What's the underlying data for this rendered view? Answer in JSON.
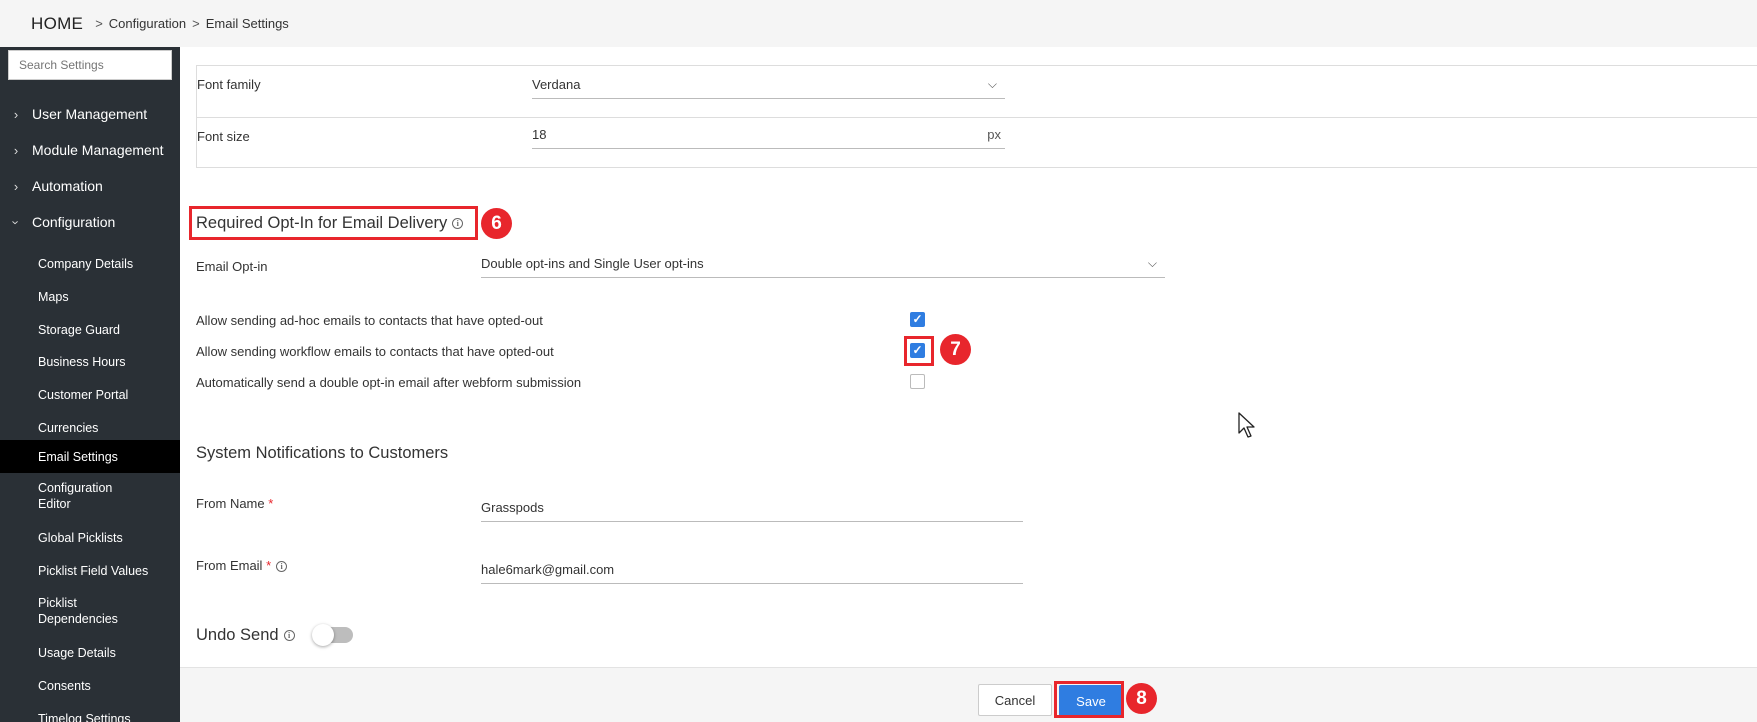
{
  "breadcrumb": {
    "home": "HOME",
    "level1": "Configuration",
    "level2": "Email Settings",
    "separator": ">"
  },
  "sidebar": {
    "search_placeholder": "Search Settings",
    "groups": [
      {
        "label": "User Management",
        "expanded": false
      },
      {
        "label": "Module Management",
        "expanded": false
      },
      {
        "label": "Automation",
        "expanded": false
      },
      {
        "label": "Configuration",
        "expanded": true
      }
    ],
    "items": [
      {
        "label": "Company Details"
      },
      {
        "label": "Maps"
      },
      {
        "label": "Storage Guard"
      },
      {
        "label": "Business Hours"
      },
      {
        "label": "Customer Portal"
      },
      {
        "label": "Currencies"
      },
      {
        "label": "Email Settings",
        "active": true
      },
      {
        "label": "Configuration Editor"
      },
      {
        "label": "Global Picklists"
      },
      {
        "label": "Picklist Field Values"
      },
      {
        "label": "Picklist Dependencies"
      },
      {
        "label": "Usage Details"
      },
      {
        "label": "Consents"
      },
      {
        "label": "Timelog Settings"
      }
    ]
  },
  "font_settings": {
    "font_family_label": "Font family",
    "font_family_value": "Verdana",
    "font_size_label": "Font size",
    "font_size_value": "18",
    "font_size_unit": "px"
  },
  "opt_in": {
    "title": "Required Opt-In for Email Delivery",
    "email_optin_label": "Email Opt-in",
    "email_optin_value": "Double opt-ins and Single User opt-ins",
    "checkboxes": [
      {
        "label": "Allow sending ad-hoc emails to contacts that have opted-out",
        "checked": true
      },
      {
        "label": "Allow sending workflow emails to contacts that have opted-out",
        "checked": true
      },
      {
        "label": "Automatically send a double opt-in email after webform submission",
        "checked": false
      }
    ]
  },
  "notifications": {
    "title": "System Notifications to Customers",
    "from_name_label": "From Name",
    "from_name_value": "Grasspods",
    "from_email_label": "From Email",
    "from_email_value": "hale6mark@gmail.com",
    "required_mark": "*"
  },
  "undo_send": {
    "title": "Undo Send",
    "enabled": false
  },
  "footer": {
    "cancel_label": "Cancel",
    "save_label": "Save"
  },
  "annotations": {
    "badge_6": "6",
    "badge_7": "7",
    "badge_8": "8"
  },
  "colors": {
    "accent": "#2f7de1",
    "highlight": "#e8262c",
    "sidebar_bg": "#2a3036",
    "sidebar_active": "#000000"
  }
}
